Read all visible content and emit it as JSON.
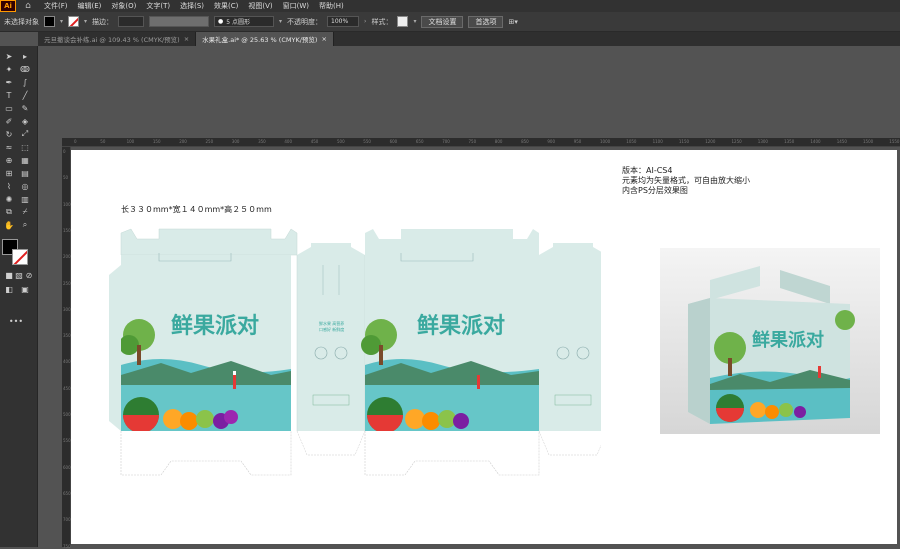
{
  "app": {
    "logo": "Ai"
  },
  "menu": [
    "文件(F)",
    "编辑(E)",
    "对象(O)",
    "文字(T)",
    "选择(S)",
    "效果(C)",
    "视图(V)",
    "窗口(W)",
    "帮助(H)"
  ],
  "control": {
    "selection_label": "未选择对象",
    "stroke_label": "描边：",
    "stroke_value": "",
    "brush_value": "5 点圆形",
    "opacity_label": "不透明度：",
    "opacity_value": "100%",
    "style_label": "样式：",
    "doc_setup": "文档设置",
    "preferences": "首选项"
  },
  "tabs": [
    {
      "label": "元旦撤谈会补练.ai @ 109.43 % (CMYK/预览)",
      "close": "×"
    },
    {
      "label": "水果礼盒.ai* @ 25.63 % (CMYK/预览)",
      "close": "×"
    }
  ],
  "ruler_h": [
    "0",
    "50",
    "100",
    "150",
    "200",
    "250",
    "300",
    "350",
    "400",
    "450",
    "500",
    "550",
    "600",
    "650",
    "700",
    "750",
    "800",
    "850",
    "900",
    "950",
    "1000",
    "1050",
    "1100",
    "1150",
    "1200",
    "1250",
    "1300",
    "1350",
    "1400",
    "1450",
    "1500",
    "1550"
  ],
  "ruler_v": [
    "0",
    "50",
    "100",
    "150",
    "200",
    "250",
    "300",
    "350",
    "400",
    "450",
    "500",
    "550",
    "600",
    "650",
    "700",
    "750"
  ],
  "artboard": {
    "version_info": [
      "版本：AI-CS4",
      "元素均为矢量格式，可自由放大缩小",
      "内含PS分层效果图"
    ],
    "dimensions": "长３３０mm*宽１４０mm*高２５０mm",
    "box_title": "鲜果派对",
    "side_text": [
      "鲜水果",
      "高营养",
      "口感好",
      "新鲜度"
    ]
  },
  "colors": {
    "box": "#d9ebe8",
    "brand": "#3aa99f",
    "sea": "#5bbfc4"
  }
}
